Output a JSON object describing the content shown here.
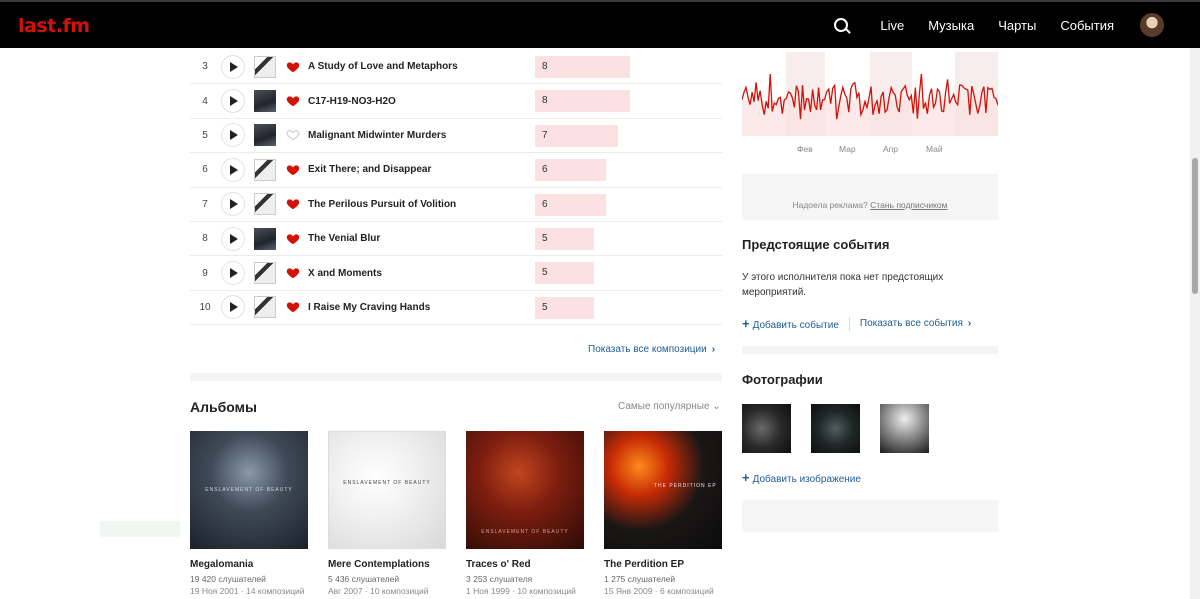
{
  "header": {
    "logo": "last.fm",
    "nav": [
      "Live",
      "Музыка",
      "Чарты",
      "События"
    ]
  },
  "tracks": [
    {
      "rank": "3",
      "title": "A Study of Love and Metaphors",
      "scrobbles": "8",
      "loved": true,
      "cover": "light",
      "bar_fraction": 1.0
    },
    {
      "rank": "4",
      "title": "C17-H19-NO3-H2O",
      "scrobbles": "8",
      "loved": true,
      "cover": "dark",
      "bar_fraction": 1.0
    },
    {
      "rank": "5",
      "title": "Malignant Midwinter Murders",
      "scrobbles": "7",
      "loved": false,
      "cover": "dark",
      "bar_fraction": 0.875
    },
    {
      "rank": "6",
      "title": "Exit There; and Disappear",
      "scrobbles": "6",
      "loved": true,
      "cover": "light",
      "bar_fraction": 0.75
    },
    {
      "rank": "7",
      "title": "The Perilous Pursuit of Volition",
      "scrobbles": "6",
      "loved": true,
      "cover": "light",
      "bar_fraction": 0.75
    },
    {
      "rank": "8",
      "title": "The Venial Blur",
      "scrobbles": "5",
      "loved": true,
      "cover": "dark",
      "bar_fraction": 0.625
    },
    {
      "rank": "9",
      "title": "X and Moments",
      "scrobbles": "5",
      "loved": true,
      "cover": "light",
      "bar_fraction": 0.625
    },
    {
      "rank": "10",
      "title": "I Raise My Craving Hands",
      "scrobbles": "5",
      "loved": true,
      "cover": "light",
      "bar_fraction": 0.625
    }
  ],
  "tracks_more": "Показать все композиции",
  "albums": {
    "title": "Альбомы",
    "sort": "Самые популярные",
    "items": [
      {
        "name": "Megalomania",
        "listeners": "19 420 слушателей",
        "meta": "19 Ноя 2001 · 14 композиций",
        "art_label": "ENSLAVEMENT OF BEAUTY"
      },
      {
        "name": "Mere Contemplations",
        "listeners": "5 436 слушателей",
        "meta": "Авг 2007 · 10 композиций",
        "art_label": "ENSLAVEMENT OF BEAUTY"
      },
      {
        "name": "Traces o' Red",
        "listeners": "3 253 слушателя",
        "meta": "1 Ноя 1999 · 10 композиций",
        "art_label": "ENSLAVEMENT OF BEAUTY"
      },
      {
        "name": "The Perdition EP",
        "listeners": "1 275 слушателей",
        "meta": "15 Янв 2009 · 6 композиций",
        "art_label": "THE PERDITION EP"
      }
    ]
  },
  "chart": {
    "months": [
      "Фев",
      "Мар",
      "Апр",
      "Май"
    ],
    "line_color": "#d51007",
    "band_color": "#fbe1e1"
  },
  "ad": {
    "text": "Надоела реклама?",
    "link": "Стань подписчиком"
  },
  "events": {
    "title": "Предстоящие события",
    "empty": "У этого исполнителя пока нет предстоящих мероприятий.",
    "add": "Добавить событие",
    "all": "Показать все события"
  },
  "photos": {
    "title": "Фотографии",
    "add": "Добавить изображение"
  }
}
